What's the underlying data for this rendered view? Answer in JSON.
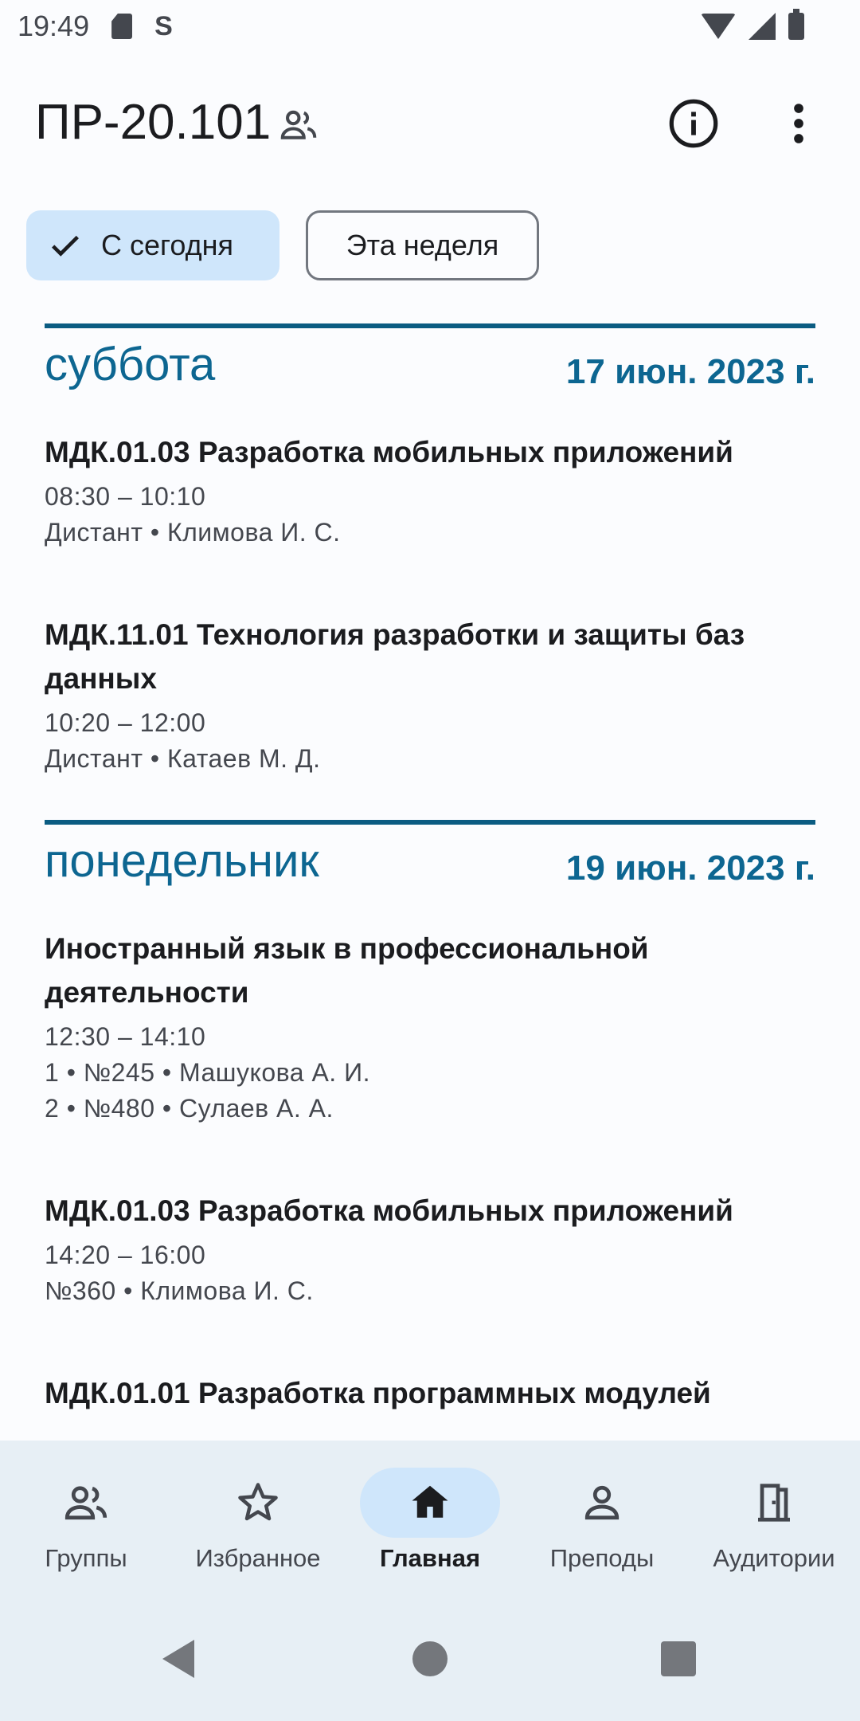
{
  "status_bar": {
    "time": "19:49",
    "icons": [
      "sd-card-icon",
      "s-icon",
      "wifi-icon",
      "signal-icon",
      "battery-icon"
    ]
  },
  "app_bar": {
    "title": "ПР-20.101",
    "icons": [
      "group-icon",
      "info-icon",
      "more-vert-icon"
    ]
  },
  "filters": {
    "today_label": "С сегодня",
    "week_label": "Эта неделя"
  },
  "colors": {
    "accent": "#0d6691",
    "chip_selected": "#cfe6fb",
    "nav_background": "#e7eff5"
  },
  "days": [
    {
      "name": "суббота",
      "date": "17 июн. 2023 г.",
      "lessons": [
        {
          "title": "МДК.01.03 Разработка мобильных приложений",
          "lines": [
            "08:30 – 10:10",
            "Дистант • Климова И. С."
          ]
        },
        {
          "title": "МДК.11.01 Технология разработки и защиты баз данных",
          "lines": [
            "10:20 – 12:00",
            "Дистант • Катаев М. Д."
          ]
        }
      ]
    },
    {
      "name": "понедельник",
      "date": "19 июн. 2023 г.",
      "lessons": [
        {
          "title": "Иностранный язык в профессиональной деятельности",
          "lines": [
            "12:30 – 14:10",
            "1 • №245 • Машукова А. И.",
            "2 • №480 • Сулаев А. А."
          ]
        },
        {
          "title": "МДК.01.03 Разработка мобильных приложений",
          "lines": [
            "14:20 – 16:00",
            "№360 • Климова И. С."
          ]
        },
        {
          "title": "МДК.01.01 Разработка программных модулей",
          "lines": []
        }
      ]
    }
  ],
  "bottom_nav": [
    {
      "label": "Группы",
      "icon": "groups-icon",
      "active": false
    },
    {
      "label": "Избранное",
      "icon": "star-icon",
      "active": false
    },
    {
      "label": "Главная",
      "icon": "home-icon",
      "active": true
    },
    {
      "label": "Преподы",
      "icon": "person-icon",
      "active": false
    },
    {
      "label": "Аудитории",
      "icon": "door-icon",
      "active": false
    }
  ]
}
